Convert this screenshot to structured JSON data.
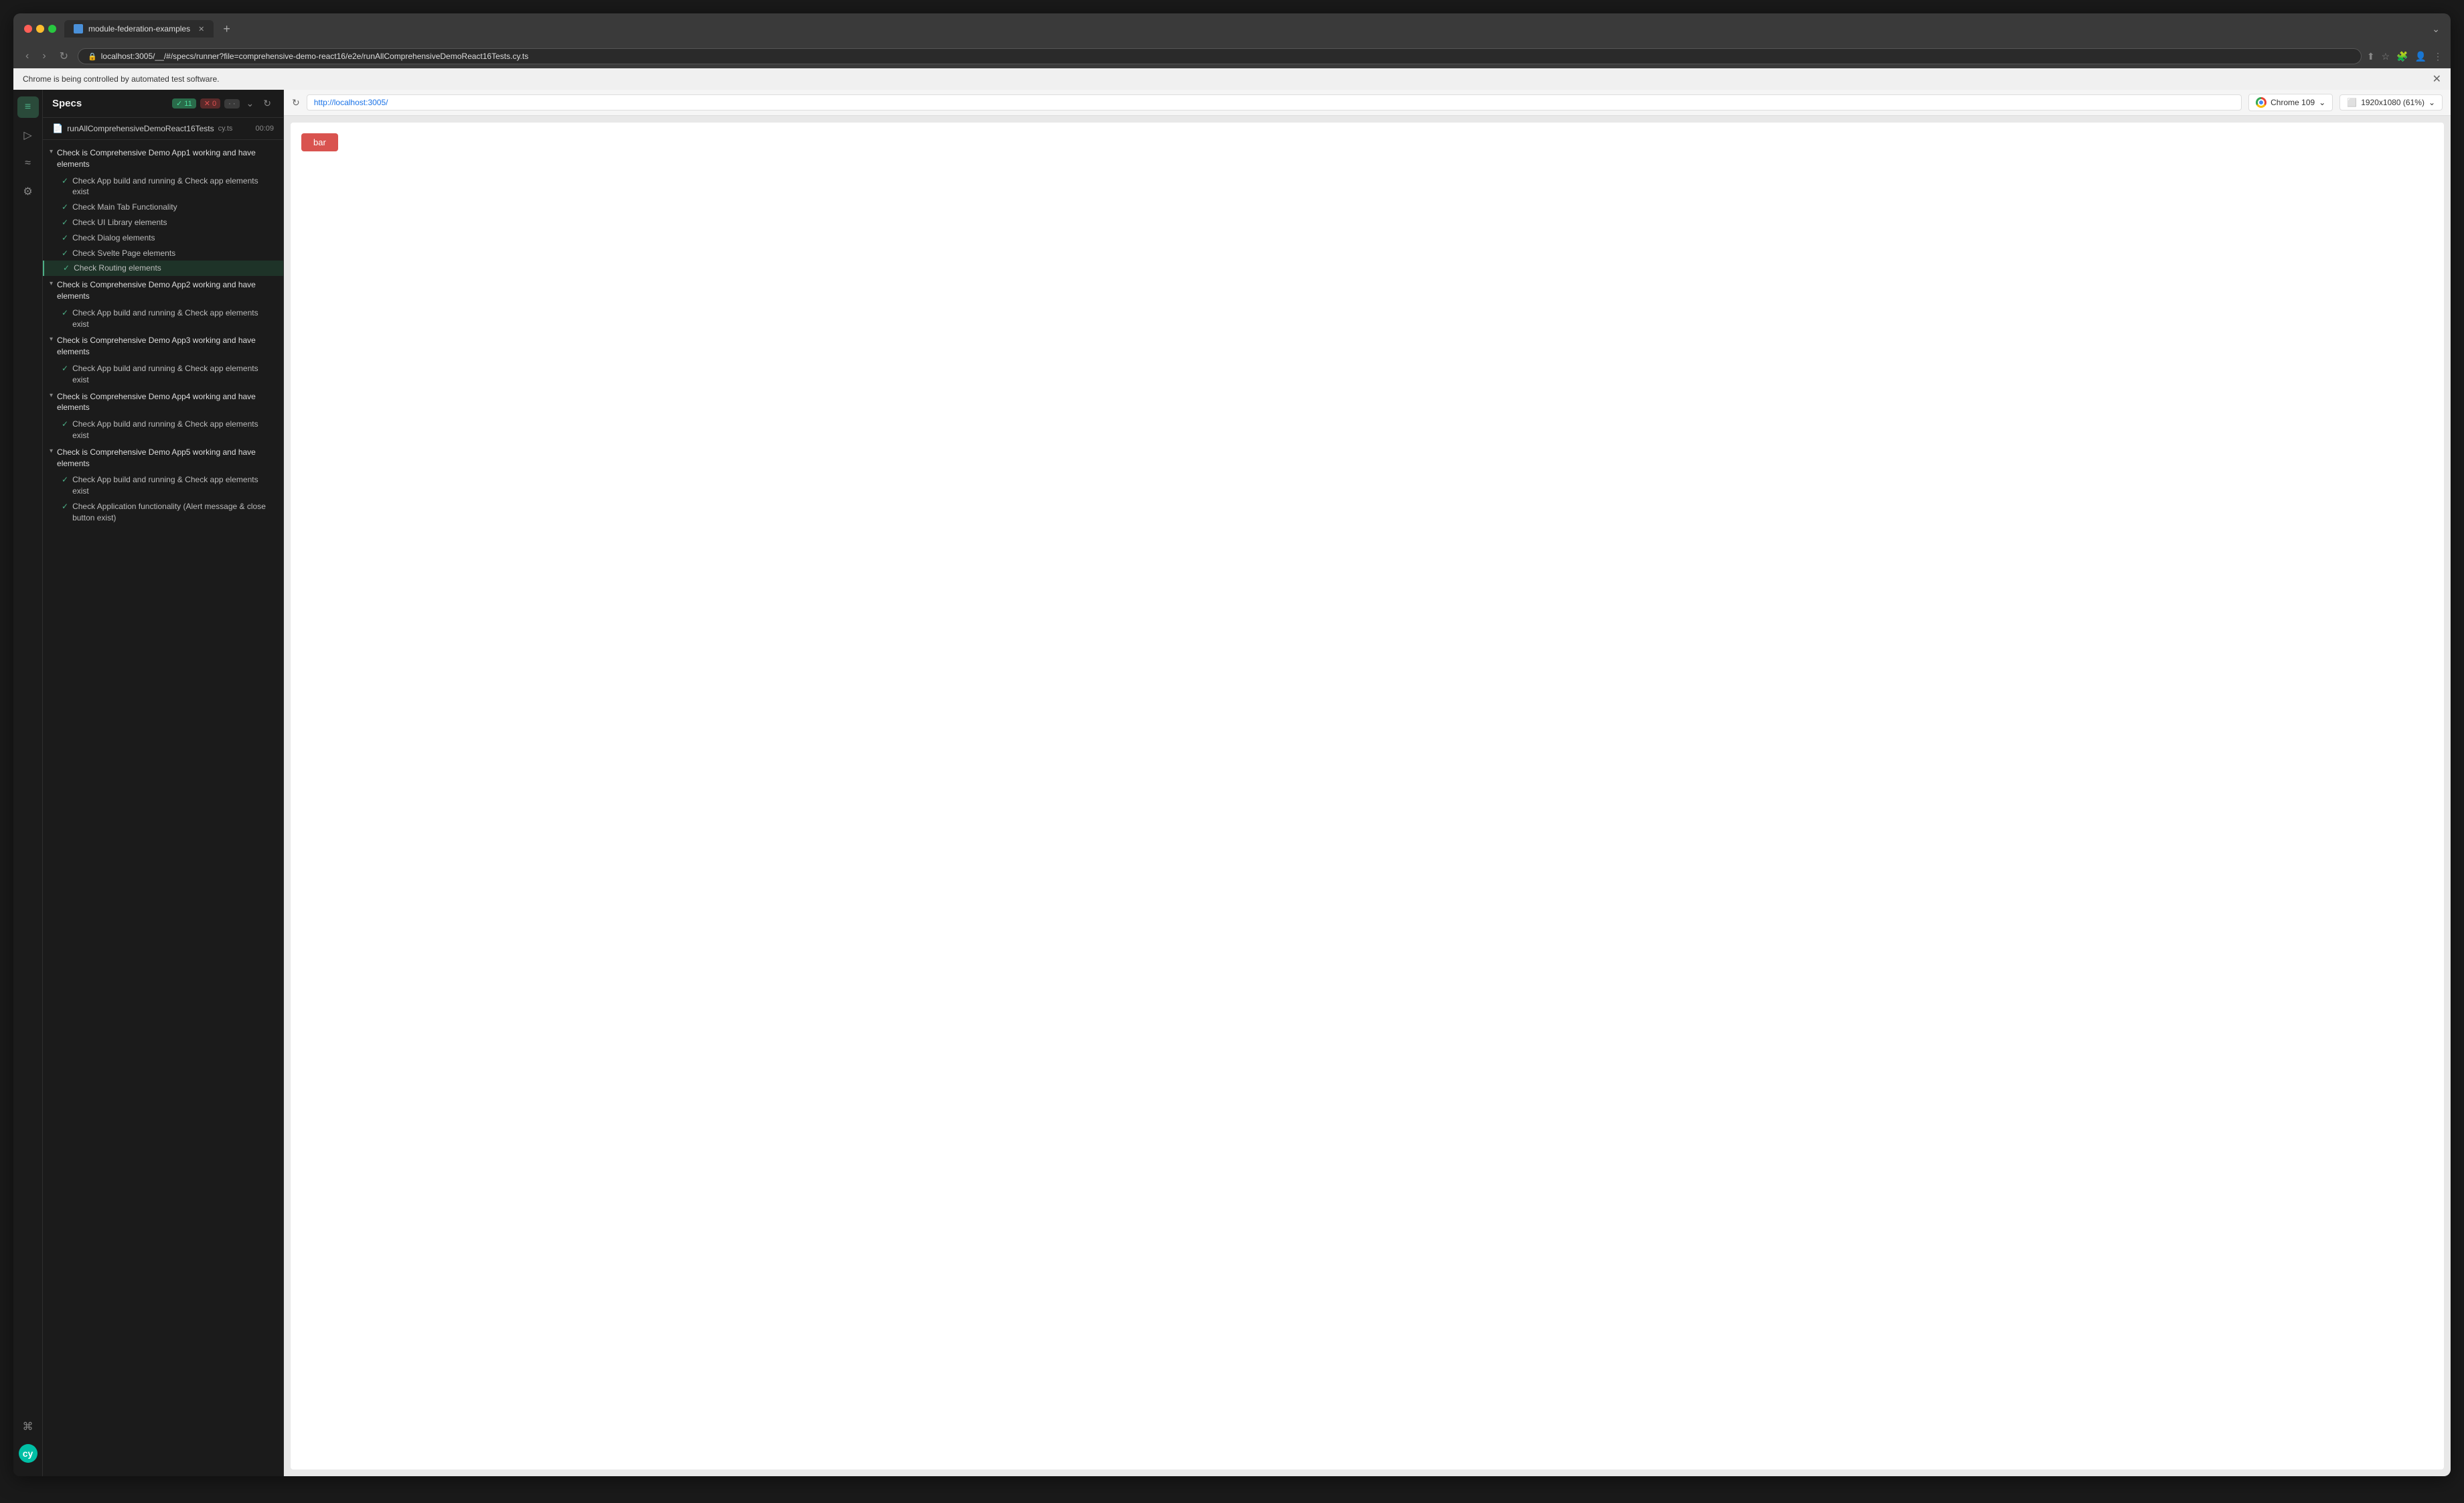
{
  "browser": {
    "tab_title": "module-federation-examples",
    "url": "localhost:3005/__/#/specs/runner?file=comprehensive-demo-react16/e2e/runAllComprehensiveDemoReact16Tests.cy.ts",
    "automation_banner": "Chrome is being controlled by automated test software.",
    "new_tab_label": "+",
    "back_btn": "‹",
    "forward_btn": "›",
    "refresh_btn": "↻"
  },
  "cypress": {
    "specs_label": "Specs",
    "pass_count": "11",
    "fail_count": "0",
    "pending_count": "·",
    "file_name": "runAllComprehensiveDemoReact16Tests",
    "file_ext": "cy.ts",
    "file_time": "00:09",
    "preview_url": "http://localhost:3005/",
    "browser_label": "Chrome 109",
    "viewport_label": "1920x1080 (61%)",
    "bar_button_label": "bar",
    "suites": [
      {
        "id": "suite1",
        "name": "Check is Comprehensive Demo App1 working and have elements",
        "tests": [
          "Check App build and running & Check app elements exist",
          "Check Main Tab Functionality",
          "Check UI Library elements",
          "Check Dialog elements",
          "Check Svelte Page elements",
          "Check Routing elements"
        ]
      },
      {
        "id": "suite2",
        "name": "Check is Comprehensive Demo App2 working and have elements",
        "tests": [
          "Check App build and running & Check app elements exist"
        ]
      },
      {
        "id": "suite3",
        "name": "Check is Comprehensive Demo App3 working and have elements",
        "tests": [
          "Check App build and running & Check app elements exist"
        ]
      },
      {
        "id": "suite4",
        "name": "Check is Comprehensive Demo App4 working and have elements",
        "tests": [
          "Check App build and running & Check app elements exist"
        ]
      },
      {
        "id": "suite5",
        "name": "Check is Comprehensive Demo App5 working and have elements",
        "tests": [
          "Check App build and running & Check app elements exist",
          "Check Application functionality (Alert message & close button exist)"
        ]
      }
    ]
  },
  "sidebar_icons": {
    "specs": "≡",
    "runs": "▷",
    "debug": "≈",
    "settings": "⚙",
    "keyboard": "⌘",
    "logo": "cy"
  }
}
